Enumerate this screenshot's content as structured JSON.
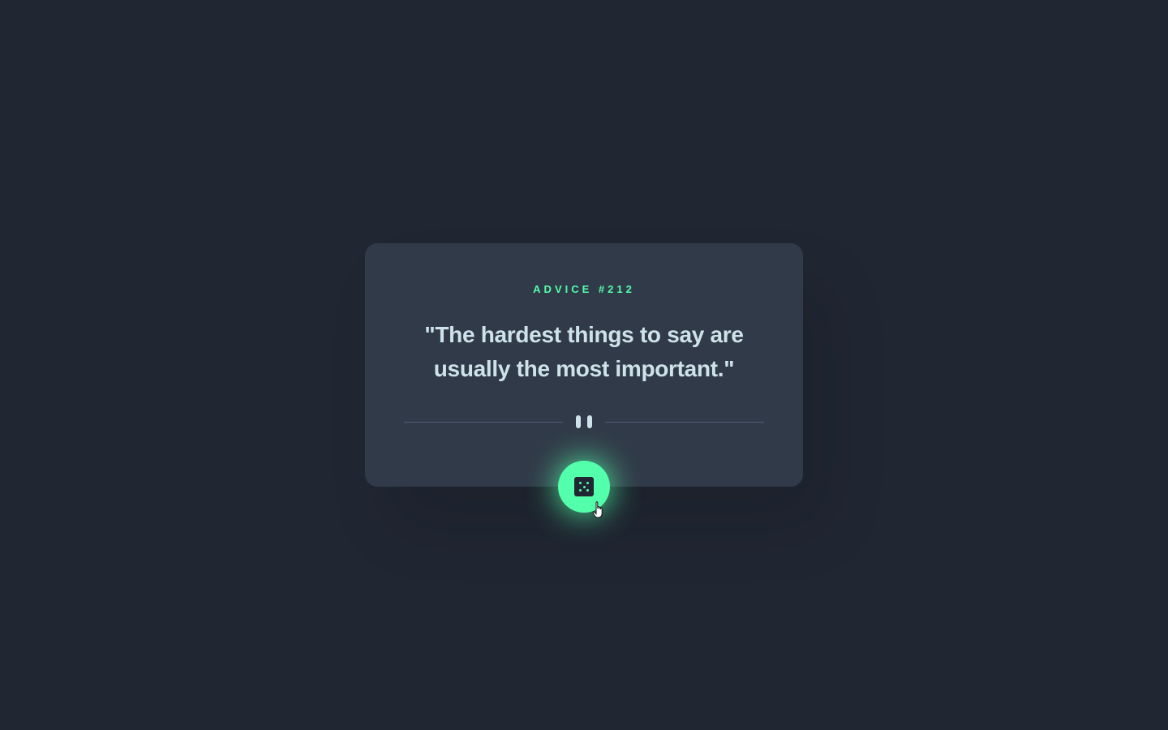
{
  "card": {
    "advice_label": "ADVICE #212",
    "quote": "\"The hardest things to say are usually the most important.\""
  },
  "divider": {
    "icon": "pause-icon"
  },
  "dice_button": {
    "icon": "dice-icon"
  },
  "colors": {
    "background": "#202632",
    "card": "#313a48",
    "accent": "#53ffaa",
    "text": "#cee3e9",
    "divider": "#4f5d74"
  }
}
